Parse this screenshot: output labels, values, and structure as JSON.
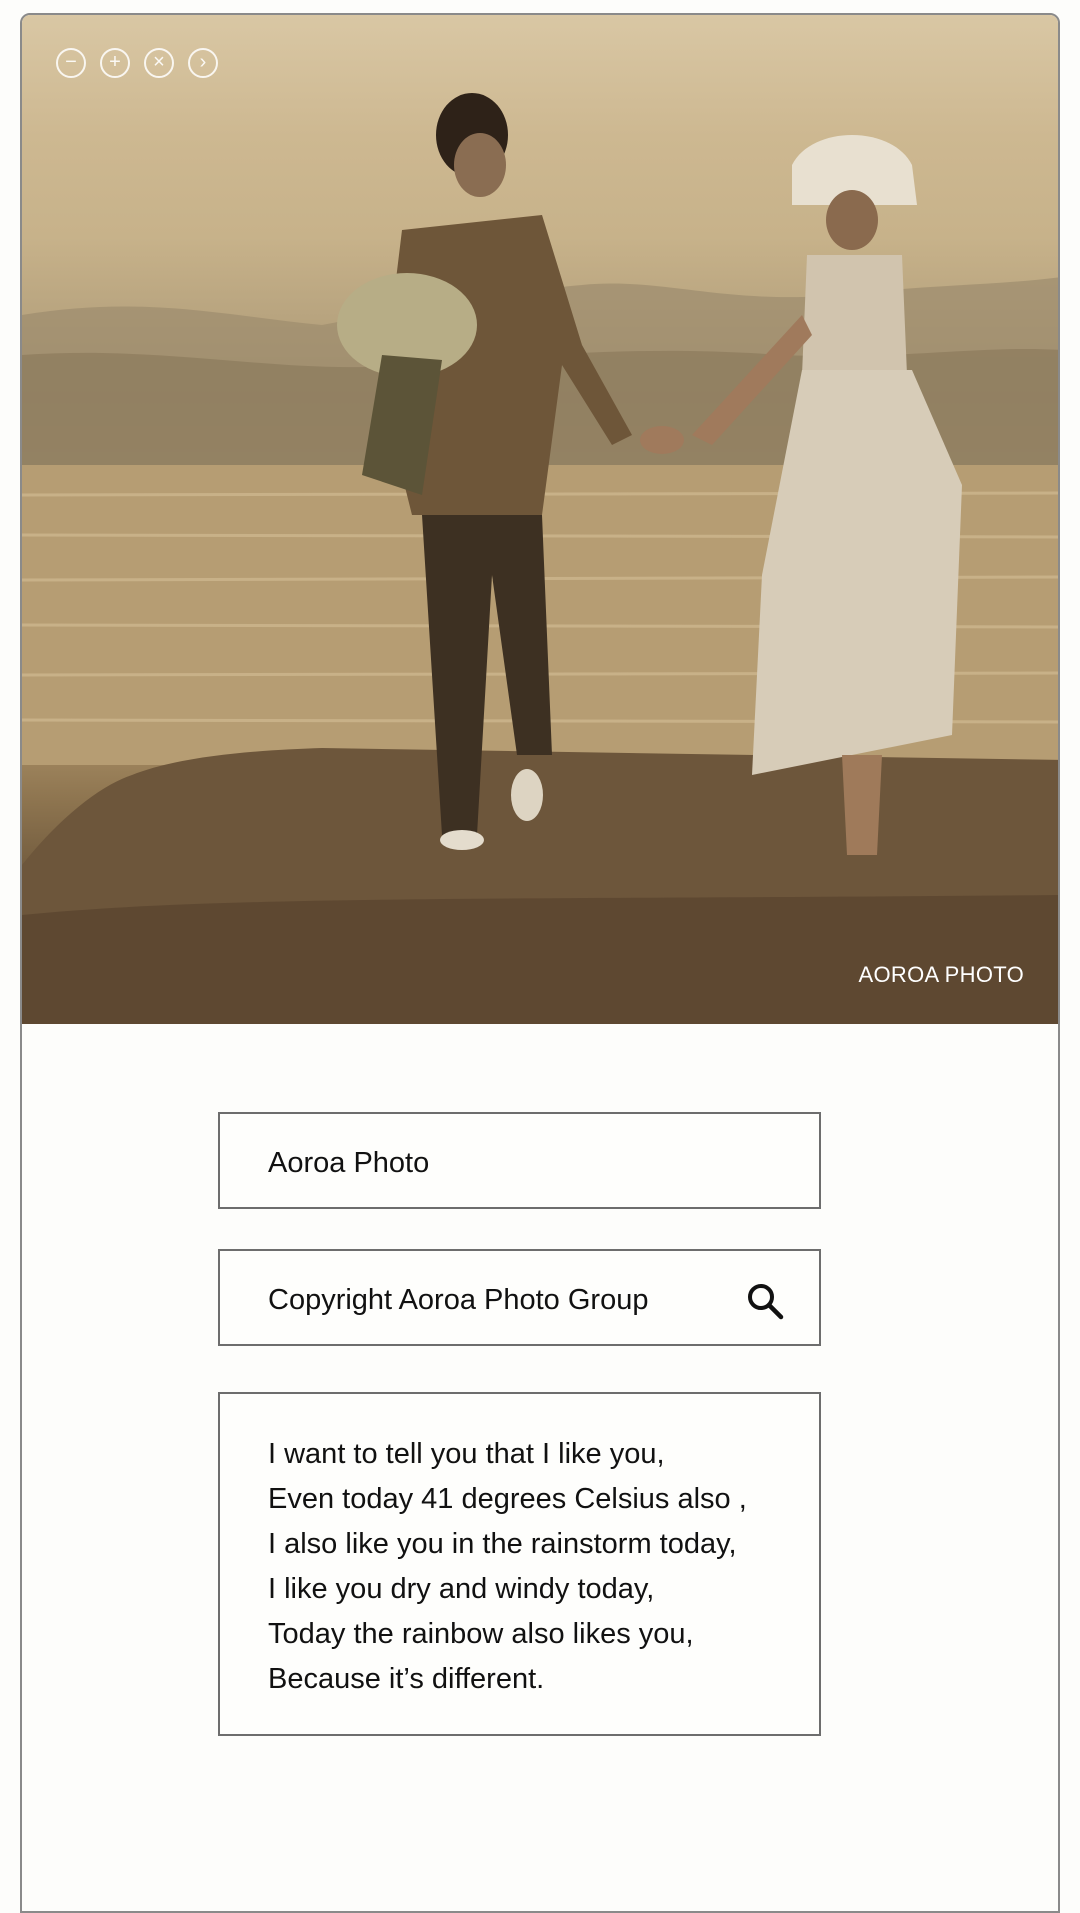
{
  "hero": {
    "window_controls": [
      {
        "name": "zoom-out-icon",
        "glyph": "−"
      },
      {
        "name": "zoom-in-icon",
        "glyph": "+"
      },
      {
        "name": "close-icon",
        "glyph": "×"
      },
      {
        "name": "next-icon",
        "glyph": "›"
      }
    ],
    "watermark": "AOROA PHOTO"
  },
  "title_field": {
    "value": "Aoroa Photo"
  },
  "search_field": {
    "value": "Copyright Aoroa Photo Group",
    "icon": "search-icon"
  },
  "message": {
    "lines": [
      "I want to tell you that I like you,",
      "Even today 41 degrees Celsius also ,",
      "I also like you in the rainstorm today,",
      "I like you dry and windy today,",
      "Today the rainbow also likes you,",
      "Because it’s different."
    ]
  }
}
